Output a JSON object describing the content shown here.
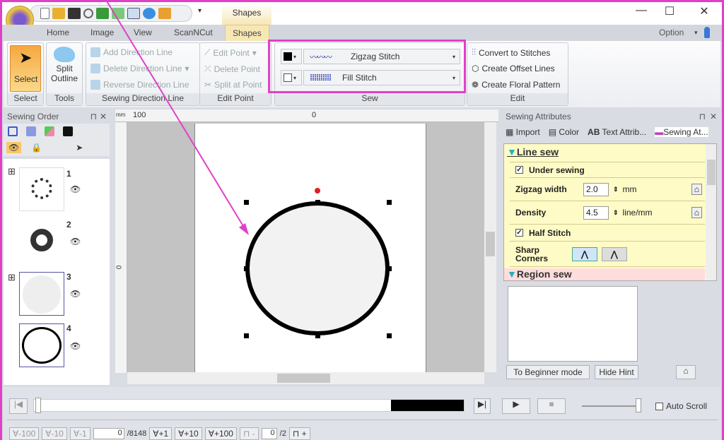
{
  "window": {
    "context_tab": "Shapes",
    "minimize": "—",
    "maximize": "☐",
    "close": "✕"
  },
  "tabs": [
    "Home",
    "Image",
    "View",
    "ScanNCut",
    "Shapes"
  ],
  "option": {
    "label": "Option"
  },
  "ribbon": {
    "select": {
      "label": "Select",
      "group": "Select"
    },
    "tools": {
      "label1": "Split",
      "label2": "Outline",
      "group": "Tools"
    },
    "direction": {
      "items": [
        "Add Direction Line",
        "Delete Direction Line",
        "Reverse Direction Line"
      ],
      "group": "Sewing Direction Line"
    },
    "edit_point": {
      "items": [
        "Edit Point",
        "Delete Point",
        "Split at Point"
      ],
      "group": "Edit Point"
    },
    "sew": {
      "line_stitch": "Zigzag Stitch",
      "region_stitch": "Fill Stitch",
      "group": "Sew",
      "highlight_color": "#e040c8"
    },
    "edit": {
      "items": [
        "Convert to Stitches",
        "Create Offset Lines",
        "Create Floral Pattern"
      ],
      "group": "Edit"
    }
  },
  "sewing_order": {
    "title": "Sewing Order",
    "items": [
      {
        "num": "1"
      },
      {
        "num": "2"
      },
      {
        "num": "3"
      },
      {
        "num": "4"
      }
    ]
  },
  "ruler": {
    "unit": "mm",
    "top_labels": [
      "100",
      "0"
    ],
    "left_label": "0"
  },
  "attributes": {
    "title": "Sewing Attributes",
    "tabs": [
      "Import",
      "Color",
      "Text Attrib...",
      "Sewing At..."
    ],
    "line_sew": "Line sew",
    "under_sewing": "Under sewing",
    "zigzag_width": {
      "label": "Zigzag width",
      "value": "2.0",
      "unit": "mm"
    },
    "density": {
      "label": "Density",
      "value": "4.5",
      "unit": "line/mm"
    },
    "half_stitch": "Half Stitch",
    "sharp_corners": "Sharp Corners",
    "region_sew": "Region sew",
    "beginner_button": "To Beginner mode",
    "hide_hint_button": "Hide Hint"
  },
  "playback": {
    "auto_scroll": "Auto Scroll",
    "progress_percent": 83
  },
  "stitch_nav": {
    "back": [
      "-100",
      "-10",
      "-1"
    ],
    "current": "0",
    "total": "/8148",
    "fwd": [
      "+1",
      "+10",
      "+100"
    ],
    "color_current": "0",
    "color_total": "/2",
    "color_minus": "-",
    "color_plus": "+"
  }
}
